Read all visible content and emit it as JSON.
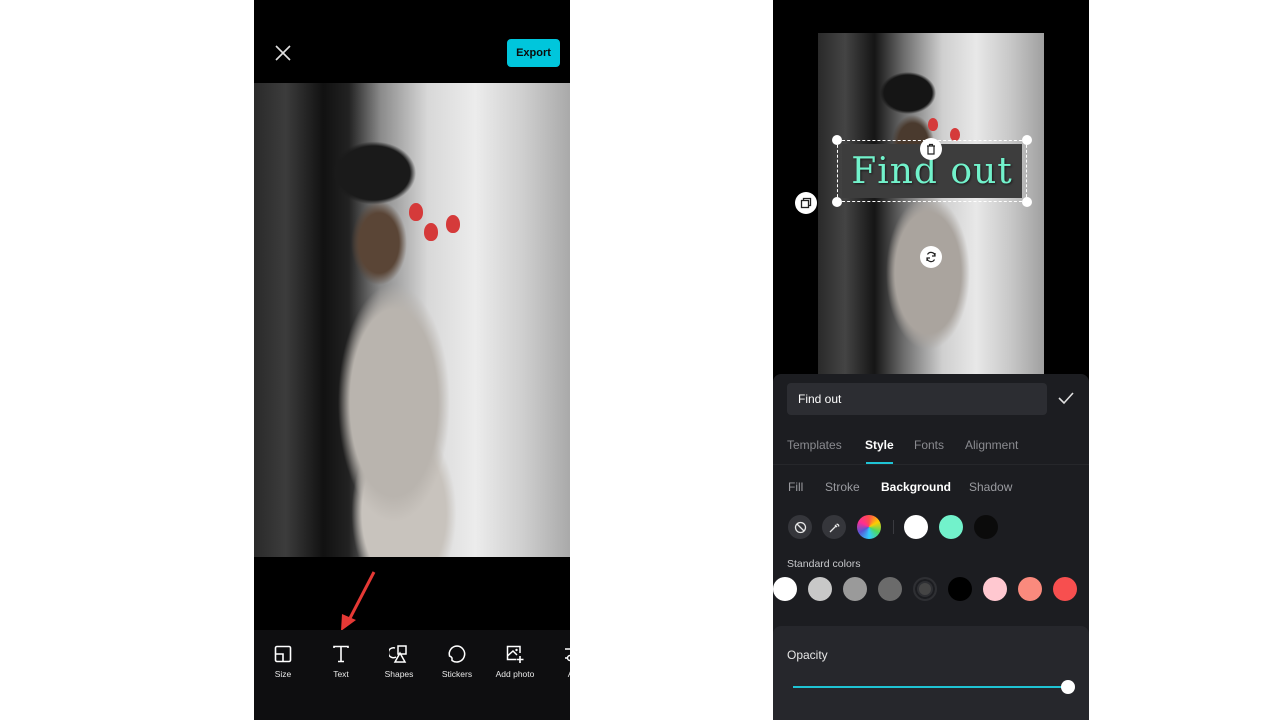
{
  "left_screen": {
    "close_icon": "close-icon",
    "export_label": "Export",
    "export_color": "#00c6dc",
    "annotation_arrow_color": "#e53935",
    "toolbar": [
      {
        "label": "Size",
        "icon": "size-icon"
      },
      {
        "label": "Text",
        "icon": "text-icon"
      },
      {
        "label": "Shapes",
        "icon": "shapes-icon"
      },
      {
        "label": "Stickers",
        "icon": "stickers-icon"
      },
      {
        "label": "Add photo",
        "icon": "add-photo-icon"
      },
      {
        "label": "Ad",
        "icon": "adjust-icon"
      }
    ]
  },
  "right_screen": {
    "overlay_text": "Find out",
    "overlay_text_color": "#72f2cb",
    "overlay_bg_color": "#3d3d3d",
    "text_input_value": "Find out",
    "tabs": [
      {
        "label": "Templates",
        "active": false
      },
      {
        "label": "Style",
        "active": true
      },
      {
        "label": "Fonts",
        "active": false
      },
      {
        "label": "Alignment",
        "active": false
      }
    ],
    "subtabs": [
      {
        "label": "Fill",
        "active": false
      },
      {
        "label": "Stroke",
        "active": false
      },
      {
        "label": "Background",
        "active": true
      },
      {
        "label": "Shadow",
        "active": false
      }
    ],
    "recent_colors": [
      "#ffffff",
      "#72f2cb",
      "#0b0b0b"
    ],
    "standard_colors_label": "Standard colors",
    "standard_colors": [
      "#ffffff",
      "#c8c8c8",
      "#9a9a9a",
      "#6b6b6b",
      "#454545",
      "#000000",
      "#ffc8d0",
      "#fa8a7d",
      "#f74f4f"
    ],
    "selected_standard_color": "#454545",
    "opacity_label": "Opacity",
    "opacity_value": 100,
    "accent_color": "#1fc3d4"
  }
}
